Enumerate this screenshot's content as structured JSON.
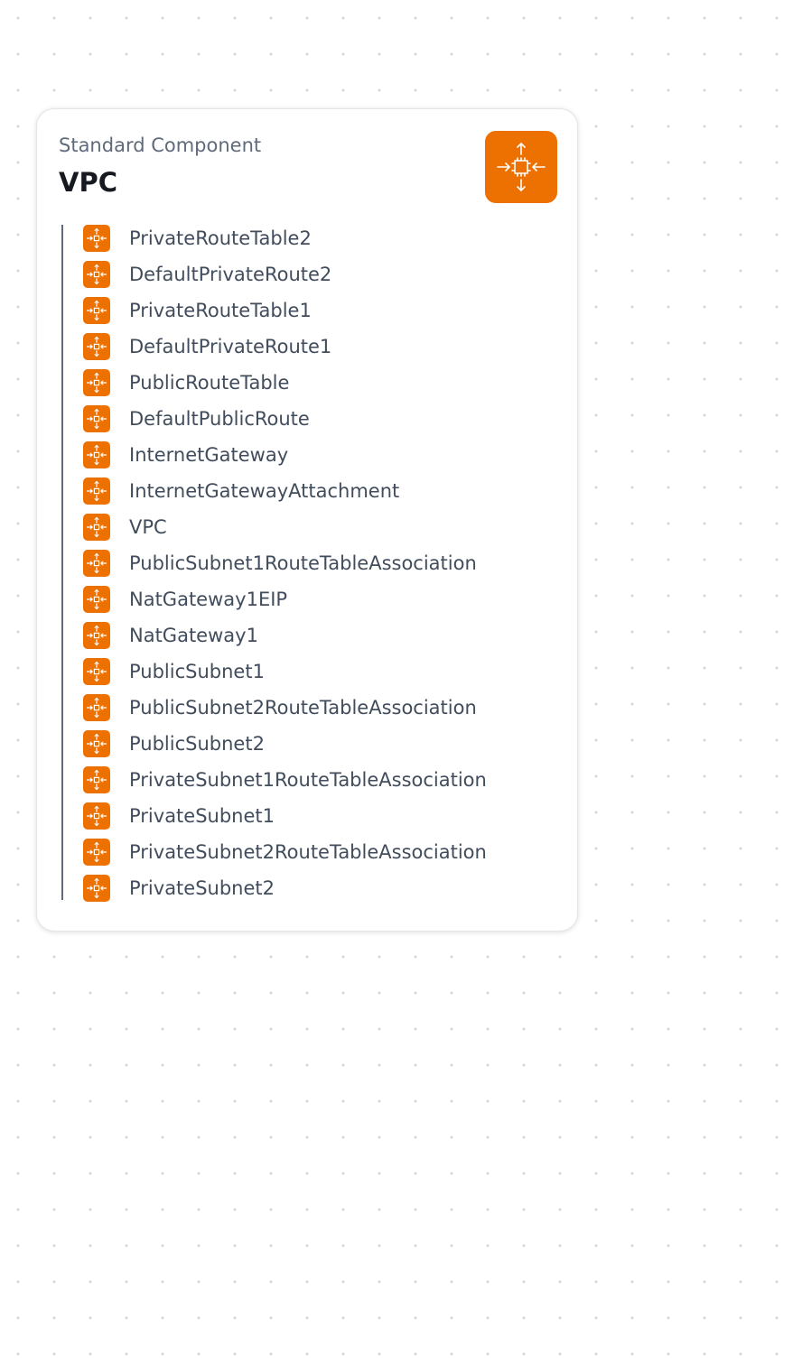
{
  "component": {
    "subtitle": "Standard Component",
    "title": "VPC",
    "icon": "vpc-router-icon",
    "accent_color": "#ed7100"
  },
  "resources": {
    "icon": "vpc-router-icon",
    "items": [
      {
        "label": "PrivateRouteTable2"
      },
      {
        "label": "DefaultPrivateRoute2"
      },
      {
        "label": "PrivateRouteTable1"
      },
      {
        "label": "DefaultPrivateRoute1"
      },
      {
        "label": "PublicRouteTable"
      },
      {
        "label": "DefaultPublicRoute"
      },
      {
        "label": "InternetGateway"
      },
      {
        "label": "InternetGatewayAttachment"
      },
      {
        "label": "VPC"
      },
      {
        "label": "PublicSubnet1RouteTableAssociation"
      },
      {
        "label": "NatGateway1EIP"
      },
      {
        "label": "NatGateway1"
      },
      {
        "label": "PublicSubnet1"
      },
      {
        "label": "PublicSubnet2RouteTableAssociation"
      },
      {
        "label": "PublicSubnet2"
      },
      {
        "label": "PrivateSubnet1RouteTableAssociation"
      },
      {
        "label": "PrivateSubnet1"
      },
      {
        "label": "PrivateSubnet2RouteTableAssociation"
      },
      {
        "label": "PrivateSubnet2"
      }
    ]
  }
}
